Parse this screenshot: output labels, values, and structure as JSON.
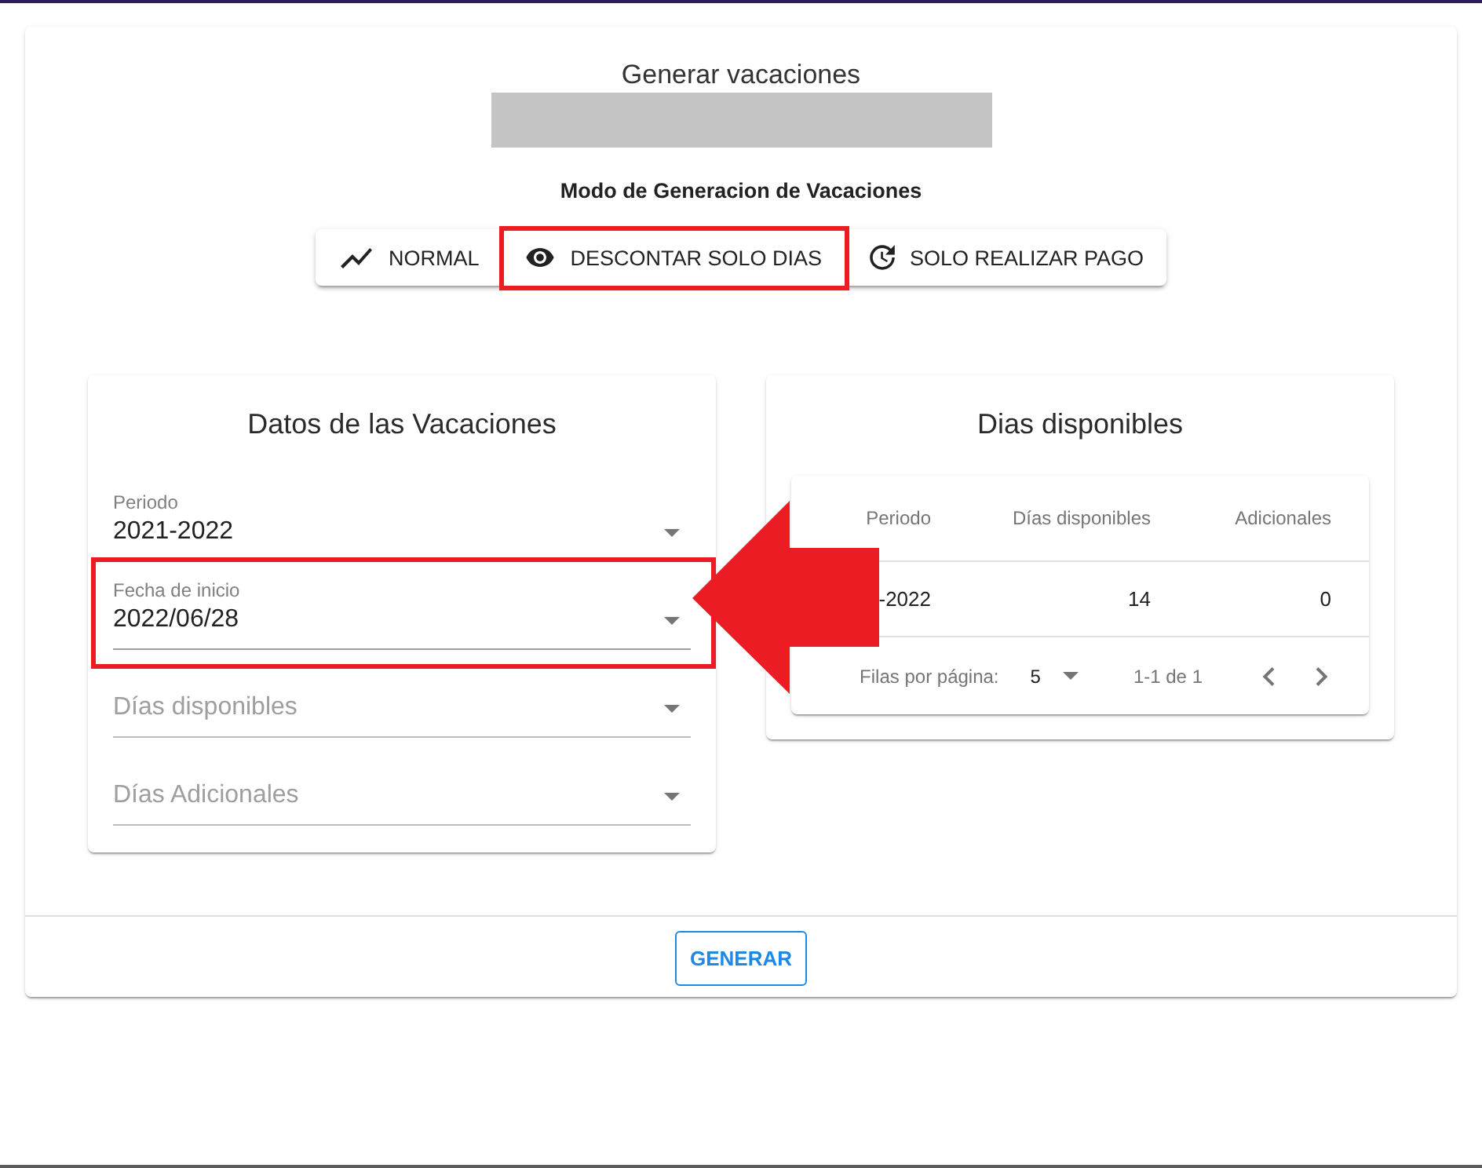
{
  "title": "Generar vacaciones",
  "mode_heading": "Modo de Generacion de Vacaciones",
  "modes": [
    {
      "label": "NORMAL",
      "highlighted": false
    },
    {
      "label": "DESCONTAR SOLO DIAS",
      "highlighted": true
    },
    {
      "label": "SOLO REALIZAR PAGO",
      "highlighted": false
    }
  ],
  "vacation_card": {
    "title": "Datos de las Vacaciones",
    "fields": [
      {
        "label": "Periodo",
        "value": "2021-2022",
        "highlighted": false,
        "arrow": false
      },
      {
        "label": "Fecha de inicio",
        "value": "2022/06/28",
        "highlighted": true,
        "arrow": true
      },
      {
        "label": "Días disponibles",
        "highlighted": false,
        "arrow": false
      },
      {
        "label": "Días Adicionales",
        "highlighted": false,
        "arrow": false
      }
    ]
  },
  "days_card": {
    "title": "Dias disponibles",
    "table": {
      "columns": [
        "Periodo",
        "Días disponibles",
        "Adicionales"
      ],
      "rows": [
        [
          "-2022",
          "14",
          "0"
        ]
      ],
      "pagination": {
        "rows_per_page_label": "Filas por página:",
        "rows_per_page": "5",
        "range": "1-1 de 1"
      }
    }
  },
  "generate_button": "GENERAR"
}
